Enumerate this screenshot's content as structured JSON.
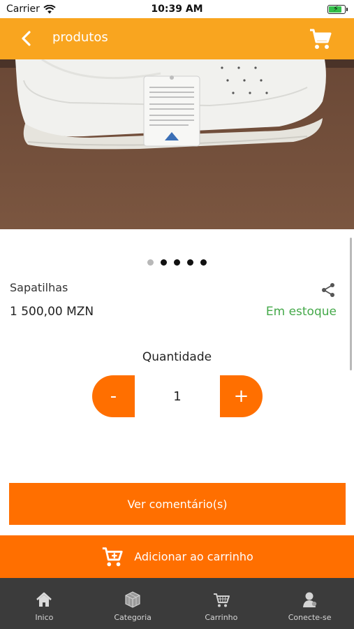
{
  "status_bar": {
    "carrier": "Carrier",
    "time": "10:39 AM"
  },
  "header": {
    "title": "produtos",
    "back_icon": "chevron-left-icon",
    "cart_icon": "cart-icon"
  },
  "product": {
    "image_alt": "white sneaker on brown background",
    "image_dots": {
      "count": 5,
      "active_index": 0
    },
    "name": "Sapatilhas",
    "price": "1 500,00 MZN",
    "stock_status": "Em estoque"
  },
  "quantity": {
    "label": "Quantidade",
    "minus_label": "-",
    "value": "1",
    "plus_label": "+"
  },
  "actions": {
    "reviews_label": "Ver comentário(s)",
    "add_to_cart_label": "Adicionar ao carrinho"
  },
  "tabs": [
    {
      "label": "Inico",
      "icon": "home-icon"
    },
    {
      "label": "Categoria",
      "icon": "cube-icon"
    },
    {
      "label": "Carrinho",
      "icon": "cart-icon"
    },
    {
      "label": "Conecte-se",
      "icon": "user-icon"
    }
  ],
  "colors": {
    "header": "#f9a51f",
    "accent": "#ff6f00",
    "stock": "#45a94a",
    "tab_bar": "#3b3b3b"
  }
}
